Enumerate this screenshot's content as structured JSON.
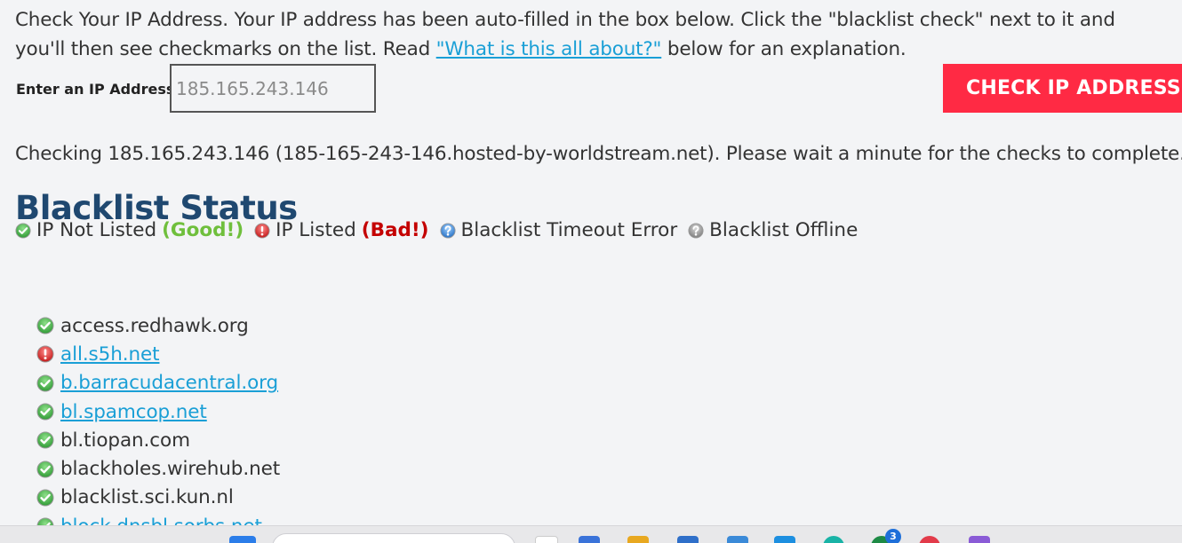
{
  "intro": {
    "text_before_link": "Check Your IP Address. Your IP address has been auto-filled in the box below. Click the \"blacklist check\" next to it and you'll then see checkmarks on the list. Read ",
    "link_text": "\"What is this all about?\"",
    "text_after_link": " below for an explanation."
  },
  "ip_form": {
    "label": "Enter an IP Address",
    "value": "185.165.243.146",
    "button_label": "CHECK IP ADDRESS"
  },
  "checking_text": "Checking 185.165.243.146 (185-165-243-146.hosted-by-worldstream.net). Please wait a minute for the checks to complete.",
  "status_heading": "Blacklist Status",
  "legend": {
    "not_listed": "IP Not Listed",
    "good": "(Good!)",
    "listed": "IP Listed",
    "bad": "(Bad!)",
    "timeout": "Blacklist Timeout Error",
    "offline": "Blacklist Offline"
  },
  "blacklists": [
    {
      "name": "access.redhawk.org",
      "status": "ok",
      "link": false
    },
    {
      "name": "all.s5h.net",
      "status": "listed",
      "link": true
    },
    {
      "name": "b.barracudacentral.org",
      "status": "ok",
      "link": true
    },
    {
      "name": "bl.spamcop.net",
      "status": "ok",
      "link": true
    },
    {
      "name": "bl.tiopan.com",
      "status": "ok",
      "link": false
    },
    {
      "name": "blackholes.wirehub.net",
      "status": "ok",
      "link": false
    },
    {
      "name": "blacklist.sci.kun.nl",
      "status": "ok",
      "link": false
    },
    {
      "name": "block.dnsbl.sorbs.net",
      "status": "ok",
      "link": true
    }
  ],
  "taskbar": {
    "notification_count": "3"
  },
  "colors": {
    "accent_button": "#ff2a44",
    "heading": "#1f4870",
    "link": "#1a9fd6",
    "good": "#6fbf3c",
    "bad": "#c40000"
  }
}
